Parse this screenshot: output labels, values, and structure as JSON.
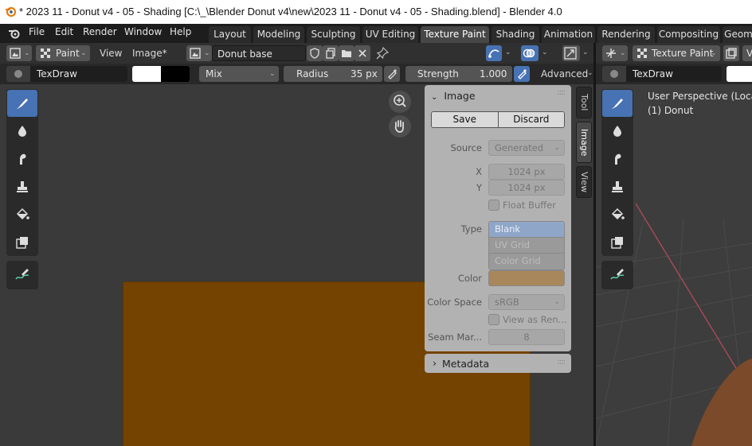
{
  "window": {
    "title": "* 2023 11 - Donut v4 - 05 - Shading [C:\\_\\Blender Donut v4\\new\\2023 11 - Donut v4 - 05 - Shading.blend] - Blender 4.0"
  },
  "menu": [
    "File",
    "Edit",
    "Render",
    "Window",
    "Help"
  ],
  "workspaces": [
    "Layout",
    "Modeling",
    "Sculpting",
    "UV Editing",
    "Texture Paint",
    "Shading",
    "Animation",
    "Rendering",
    "Compositing",
    "Geom"
  ],
  "active_workspace": "Texture Paint",
  "image_editor": {
    "mode": "Paint",
    "view_menu": "View",
    "image_menu": "Image*",
    "image_name": "Donut base",
    "brush": "TexDraw",
    "blend": "Mix",
    "radius_label": "Radius",
    "radius_value": "35 px",
    "strength_label": "Strength",
    "strength_value": "1.000",
    "advanced": "Advanced",
    "canvas_color": "#744301",
    "primary_color": "#ffffff",
    "secondary_color": "#000000"
  },
  "npanel": {
    "header": "Image",
    "save": "Save",
    "discard": "Discard",
    "source_label": "Source",
    "source_value": "Generated",
    "x_label": "X",
    "x_value": "1024 px",
    "y_label": "Y",
    "y_value": "1024 px",
    "float_buffer": "Float Buffer",
    "type_label": "Type",
    "types": [
      "Blank",
      "UV Grid",
      "Color Grid"
    ],
    "selected_type": "Blank",
    "color_label": "Color",
    "color_value": "#a9875c",
    "colorspace_label": "Color Space",
    "colorspace_value": "sRGB",
    "view_as_render": "View as Ren...",
    "seam_label": "Seam Mar...",
    "seam_value": "8",
    "metadata": "Metadata",
    "tabs": [
      "Tool",
      "Image",
      "View"
    ]
  },
  "viewport": {
    "mode": "Texture Paint",
    "brush": "TexDraw",
    "perspective": "User Perspective (Local)",
    "object": "(1) Donut",
    "extra_btn": "V"
  }
}
